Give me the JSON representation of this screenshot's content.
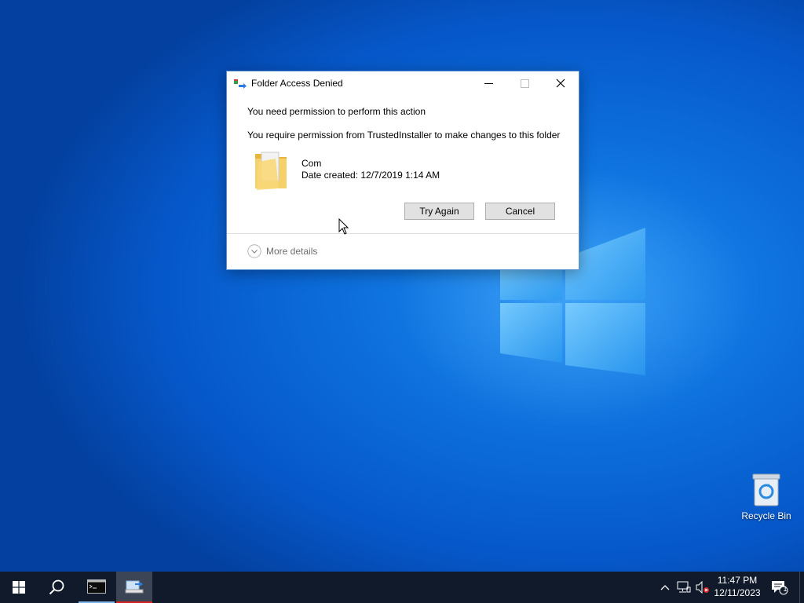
{
  "desktop": {
    "icons": [
      {
        "label": "Recycle Bin",
        "icon": "recycle-bin-icon"
      }
    ]
  },
  "dialog": {
    "title": "Folder Access Denied",
    "title_icon": "folder-access-icon",
    "controls": [
      "minimize",
      "maximize",
      "close"
    ],
    "message_primary": "You need permission to perform this action",
    "message_secondary": "You require permission from TrustedInstaller to make changes to this folder",
    "item": {
      "name": "Com",
      "date_created": "Date created: 12/7/2019 1:14 AM",
      "icon": "folder-icon"
    },
    "buttons": {
      "try_again": "Try Again",
      "cancel": "Cancel"
    },
    "more_details": "More details"
  },
  "taskbar": {
    "apps": [
      {
        "name": "start",
        "icon": "windows-start-icon"
      },
      {
        "name": "search",
        "icon": "search-icon"
      },
      {
        "name": "command-prompt",
        "icon": "cmd-icon"
      },
      {
        "name": "file-transfer",
        "icon": "app-icon",
        "active": true
      }
    ],
    "clock": {
      "time": "11:47 PM",
      "date": "12/11/2023"
    },
    "notification_count": "1"
  },
  "colors": {
    "accent": "#0078d7",
    "taskbar": "#101a2a",
    "active_indicator": "#d62222"
  }
}
